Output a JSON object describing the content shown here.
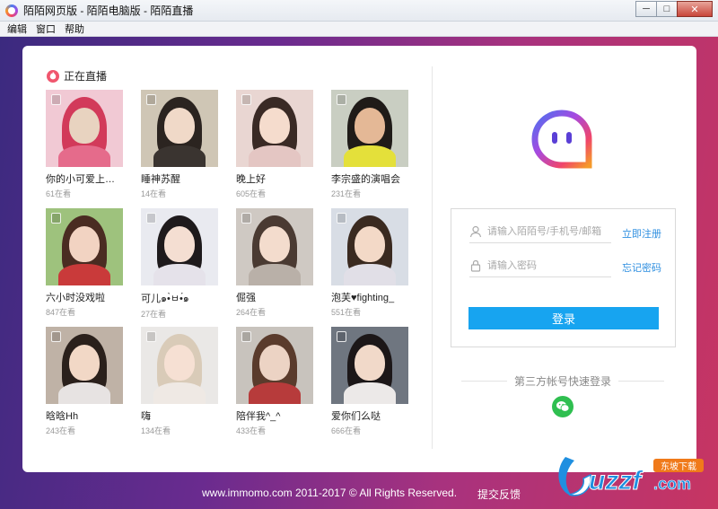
{
  "window": {
    "title": "陌陌网页版 - 陌陌电脑版 - 陌陌直播",
    "minimize": "─",
    "maximize": "□",
    "close": "✕"
  },
  "menu": [
    "编辑",
    "窗口",
    "帮助"
  ],
  "live": {
    "heading": "正在直播",
    "streams": [
      {
        "name": "你的小可爱上…",
        "count": "61在看",
        "colors": [
          "#f1c9d4",
          "#e8d3c0",
          "#d23a5a",
          "#e56b8b"
        ]
      },
      {
        "name": "睡神苏醒",
        "count": "14在看",
        "colors": [
          "#cfc6b5",
          "#f0d9c8",
          "#2b2420",
          "#3a3430"
        ]
      },
      {
        "name": "晚上好",
        "count": "605在看",
        "colors": [
          "#e9d6d2",
          "#f5dccd",
          "#3a2a25",
          "#e4c6c3"
        ]
      },
      {
        "name": "李宗盛的演唱会",
        "count": "231在看",
        "colors": [
          "#c9cec2",
          "#e4b896",
          "#1f1b18",
          "#e4e03a"
        ]
      },
      {
        "name": "六小时没戏啦",
        "count": "847在看",
        "colors": [
          "#9ec27d",
          "#f2d3c2",
          "#4a2c22",
          "#c93a3a"
        ]
      },
      {
        "name": "可儿๑•̀ㅂ•́๑",
        "count": "27在看",
        "colors": [
          "#e9eaf0",
          "#f4ded2",
          "#1e1a1c",
          "#e5e2ea"
        ]
      },
      {
        "name": "倔强",
        "count": "264在看",
        "colors": [
          "#cfc9c3",
          "#f3dccd",
          "#4a3a32",
          "#b9b0a8"
        ]
      },
      {
        "name": "泡芙♥fighting_",
        "count": "551在看",
        "colors": [
          "#d8dde5",
          "#f3d9c7",
          "#3a2a20",
          "#e1dfe7"
        ]
      },
      {
        "name": "晗晗Hh",
        "count": "243在看",
        "colors": [
          "#bfb2a6",
          "#f2d8c6",
          "#2a201b",
          "#e7e3e2"
        ]
      },
      {
        "name": "嗨",
        "count": "134在看",
        "colors": [
          "#eae8e6",
          "#f6e0d3",
          "#d9cbb8",
          "#efe9e4"
        ]
      },
      {
        "name": "陪伴我^_^",
        "count": "433在看",
        "colors": [
          "#c8c3bd",
          "#ecd3c4",
          "#5a3b2c",
          "#b73b3b"
        ]
      },
      {
        "name": "爱你们么哒",
        "count": "666在看",
        "colors": [
          "#6f7680",
          "#f1d9c9",
          "#1c1718",
          "#ece9e8"
        ]
      }
    ]
  },
  "login": {
    "account_placeholder": "请输入陌陌号/手机号/邮箱",
    "password_placeholder": "请输入密码",
    "register": "立即注册",
    "forgot": "忘记密码",
    "submit": "登录",
    "third_party": "第三方帐号快速登录",
    "third_party_icon": "wechat-icon"
  },
  "footer": {
    "copyright": "www.immomo.com 2011-2017 © All Rights Reserved.",
    "feedback": "提交反馈"
  },
  "watermark": {
    "text": "uzzf",
    "suffix": ".com",
    "badge": "东坡下载"
  },
  "colors": {
    "accent": "#17a4f0",
    "link": "#2f8fe0",
    "wechat": "#2fbf50",
    "live": "#f0566e"
  }
}
